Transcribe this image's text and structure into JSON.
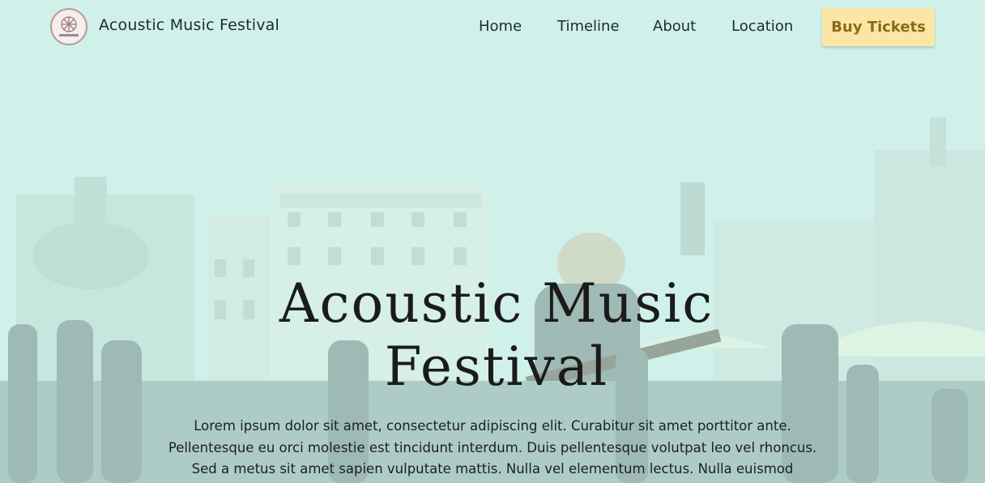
{
  "brand": {
    "name": "Acoustic Music Festival",
    "logo_icon": "festival-logo-icon"
  },
  "nav": {
    "links": [
      "Home",
      "Timeline",
      "About",
      "Location"
    ],
    "cta_label": "Buy Tickets"
  },
  "hero": {
    "title_line1": "Acoustic Music",
    "title_line2": "Festival",
    "paragraph_line1": "Lorem ipsum dolor sit amet, consectetur adipiscing elit. Curabitur sit amet porttitor ante.",
    "paragraph_line2": "Pellentesque eu orci molestie est tincidunt interdum. Duis pellentesque volutpat leo vel rhoncus.",
    "paragraph_line3": "Sed a metus sit amet sapien vulputate mattis. Nulla vel elementum lectus. Nulla euismod"
  },
  "colors": {
    "overlay": "#d6faf2",
    "cta_bg": "#fbe6a6",
    "cta_text": "#8a6a1a"
  }
}
